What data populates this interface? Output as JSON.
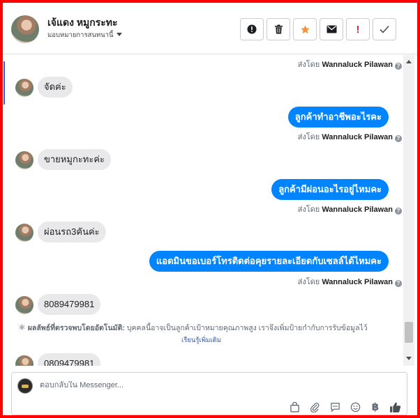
{
  "header": {
    "contact_name": "เจ้แดง หมูกระทะ",
    "assign_label": "มอบหมายการสนทนานี้",
    "buttons": [
      {
        "name": "info",
        "label": "!"
      },
      {
        "name": "delete",
        "label": ""
      },
      {
        "name": "star",
        "label": ""
      },
      {
        "name": "mail",
        "label": ""
      },
      {
        "name": "spam",
        "label": "!"
      },
      {
        "name": "done",
        "label": ""
      }
    ]
  },
  "conversation": {
    "sent_by_prefix": "ส่งโดย",
    "sent_by_name": "Wannaluck Pilawan",
    "messages": [
      {
        "from": "customer",
        "text": "จัดค่ะ"
      },
      {
        "from": "page",
        "text": "ลูกค้าทำอาชีพอะไรคะ"
      },
      {
        "from": "customer",
        "text": "ขายหมูกะทะค่ะ"
      },
      {
        "from": "page",
        "text": "ลูกค้ามีผ่อนอะไรอยู่ไหมคะ"
      },
      {
        "from": "customer",
        "text": "ผ่อนรถ3คันค่ะ"
      },
      {
        "from": "page",
        "text": "แอดมินขอเบอร์โทรติดต่อคุยรายละเอียดกับเซลล์ได้ไหมคะ"
      },
      {
        "from": "customer",
        "text": "8089479981"
      },
      {
        "from": "customer",
        "text": "0809479981"
      }
    ],
    "auto_detect": {
      "title": "ผลลัพธ์ที่ตรวจพบโดยอัตโนมัติ:",
      "text": "บุคคลนี้อาจเป็นลูกค้าเป้าหมายคุณภาพสูง เราจึงเพิ่มป้ายกำกับการรับข้อมูลไว้",
      "learn_more": "เรียนรู้เพิ่มเติม"
    }
  },
  "composer": {
    "placeholder": "ตอบกลับใน Messenger...",
    "tools": [
      "shop-bag-icon",
      "attachment-icon",
      "saved-reply-icon",
      "emoji-icon",
      "baht-icon",
      "like-icon"
    ]
  },
  "colors": {
    "accent": "#0084ff",
    "frame": "#ff0000",
    "incoming_bubble": "#e9e9eb"
  }
}
